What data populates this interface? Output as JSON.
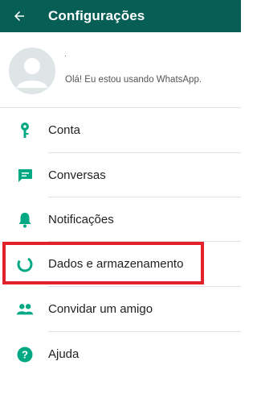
{
  "app_bar": {
    "title": "Configurações",
    "background": "#075e54",
    "back_icon": "arrow-left-icon"
  },
  "profile": {
    "name": "·",
    "status": "Olá! Eu estou usando WhatsApp.",
    "avatar_icon": "default-avatar-icon"
  },
  "menu": {
    "icon_color": "#00a884",
    "items": [
      {
        "label": "Conta",
        "icon": "key-icon"
      },
      {
        "label": "Conversas",
        "icon": "chat-icon"
      },
      {
        "label": "Notificações",
        "icon": "bell-icon"
      },
      {
        "label": "Dados e armazenamento",
        "icon": "data-usage-icon"
      },
      {
        "label": "Convidar um amigo",
        "icon": "people-icon"
      },
      {
        "label": "Ajuda",
        "icon": "help-icon"
      }
    ]
  },
  "highlight": {
    "target": "Dados e armazenamento",
    "color": "#e3212b"
  }
}
